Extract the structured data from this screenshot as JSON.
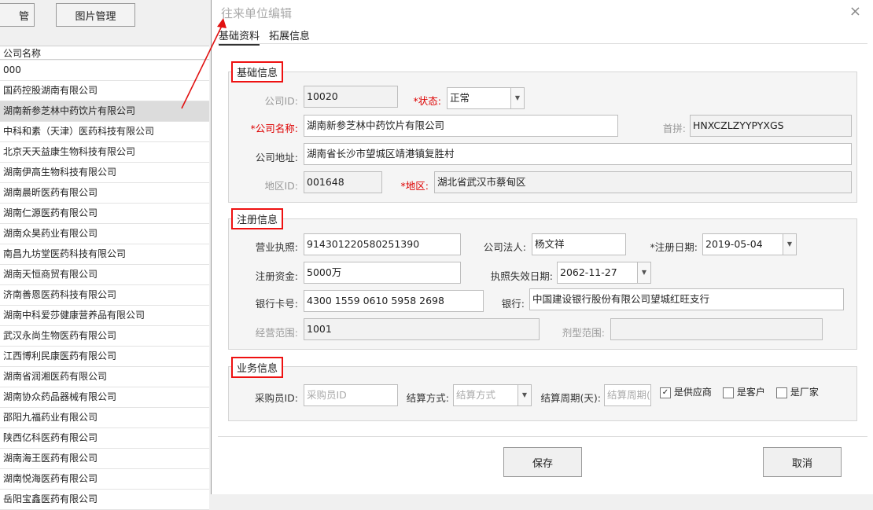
{
  "left_panel": {
    "btn_manage_partial": "管",
    "btn_image_manage": "图片管理",
    "column_header": "公司名称",
    "search_value": "000",
    "rows": [
      "国药控股湖南有限公司",
      "湖南新参芝林中药饮片有限公司",
      "中科和素（天津）医药科技有限公司",
      "北京天天益康生物科技有限公司",
      "湖南伊高生物科技有限公司",
      "湖南晨昕医药有限公司",
      "湖南仁源医药有限公司",
      "湖南众昊药业有限公司",
      "南昌九坊堂医药科技有限公司",
      "湖南天恒商贸有限公司",
      "济南善恩医药科技有限公司",
      "湖南中科爱莎健康营养品有限公司",
      "武汉永尚生物医药有限公司",
      "江西博利民康医药有限公司",
      "湖南省润湘医药有限公司",
      "湖南协众药品器械有限公司",
      "邵阳九福药业有限公司",
      "陕西亿科医药有限公司",
      "湖南海王医药有限公司",
      "湖南悦海医药有限公司",
      "岳阳宝鑫医药有限公司"
    ],
    "selected_index": 1
  },
  "dialog": {
    "title": "往来单位编辑",
    "close_glyph": "×",
    "tabs": [
      "基础资料",
      "拓展信息"
    ],
    "basic": {
      "group_title": "基础信息",
      "company_id_label": "公司ID:",
      "company_id": "10020",
      "status_label": "*状态:",
      "status": "正常",
      "company_name_label": "*公司名称:",
      "company_name": "湖南新参芝林中药饮片有限公司",
      "pinyin_label": "首拼:",
      "pinyin": "HNXCZLZYYPYXGS",
      "address_label": "公司地址:",
      "address": "湖南省长沙市望城区靖港镇复胜村",
      "region_id_label": "地区ID:",
      "region_id": "001648",
      "region_label": "*地区:",
      "region": "湖北省武汉市蔡甸区"
    },
    "register": {
      "group_title": "注册信息",
      "license_label": "营业执照:",
      "license": "914301220580251390",
      "legal_person_label": "公司法人:",
      "legal_person": "杨文祥",
      "reg_date_label": "*注册日期:",
      "reg_date": "2019-05-04",
      "capital_label": "注册资金:",
      "capital": "5000万",
      "expiry_label": "执照失效日期:",
      "expiry": "2062-11-27",
      "bank_card_label": "银行卡号:",
      "bank_card": "4300 1559 0610 5958 2698",
      "bank_label": "银行:",
      "bank": "中国建设银行股份有限公司望城红旺支行",
      "scope_label": "经营范围:",
      "scope": "1001",
      "dosage_label": "剂型范围:",
      "dosage": ""
    },
    "business": {
      "group_title": "业务信息",
      "buyer_label": "采购员ID:",
      "buyer_placeholder": "采购员ID",
      "settle_label": "结算方式:",
      "settle_placeholder": "结算方式",
      "period_label": "结算周期(天):",
      "period_placeholder": "结算周期(",
      "supplier_label": "是供应商",
      "supplier_checked": true,
      "customer_label": "是客户",
      "customer_checked": false,
      "factory_label": "是厂家",
      "factory_checked": false
    },
    "save_label": "保存",
    "cancel_label": "取消"
  },
  "colors": {
    "highlight_red": "#e11111",
    "required_red": "#d00000",
    "selected_row": "#dcdcdc"
  }
}
